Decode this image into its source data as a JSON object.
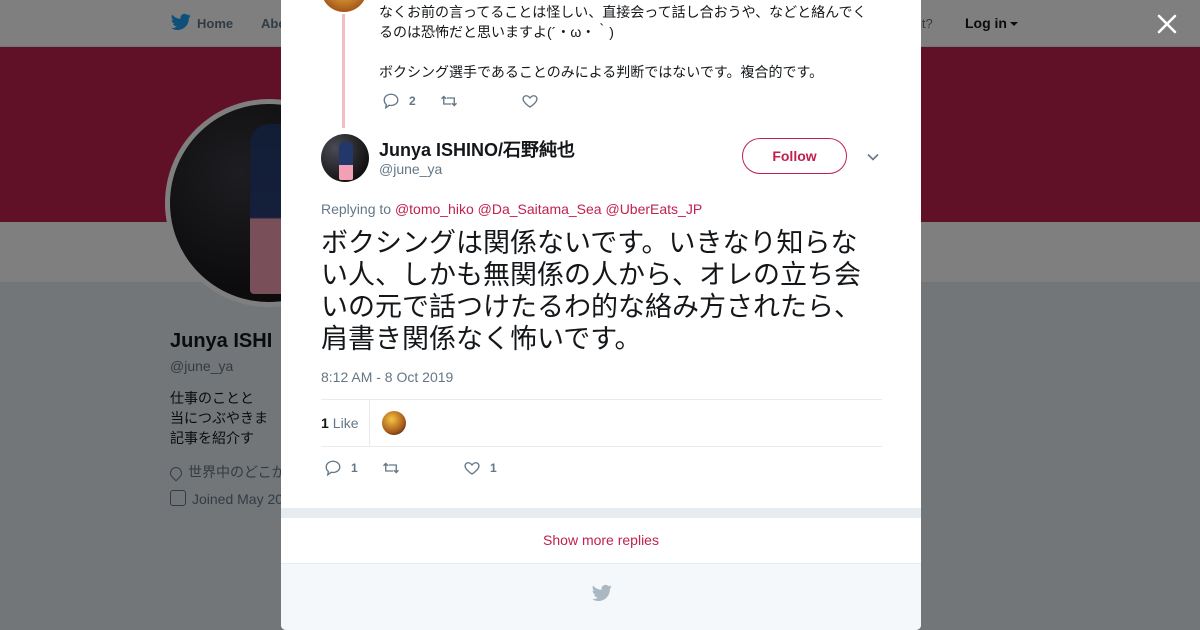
{
  "background": {
    "nav": {
      "home_label": "Home",
      "about_label": "Abo",
      "account_prompt": "account?",
      "login_label": "Log in"
    },
    "profile": {
      "name": "Junya ISHI",
      "handle": "@june_ya",
      "bio": "仕事のことと\n当につぶやきま\n記事を紹介す",
      "location": "世界中のどこか",
      "joined": "Joined May 20"
    }
  },
  "colors": {
    "accent": "#c0214f",
    "thread_line": "#f3bcc9",
    "muted": "#657786"
  },
  "modal": {
    "previous_tweet": {
      "text": "なくお前の言ってることは怪しい、直接会って話し合おうや、などと絡んでく\nるのは恐怖だと思いますよ(´・ω・｀)\n\nボクシング選手であることのみによる判断ではないです。複合的です。",
      "replies": "2",
      "retweets": "",
      "likes": ""
    },
    "tweet": {
      "author_name": "Junya ISHINO/石野純也",
      "author_handle": "@june_ya",
      "follow_label": "Follow",
      "replying_prefix": "Replying to",
      "replying_to": [
        "@tomo_hiko",
        "@Da_Saitama_Sea",
        "@UberEats_JP"
      ],
      "text": "ボクシングは関係ないです。いきなり知らない人、しかも無関係の人から、オレの立ち会いの元で話つけたるわ的な絡み方されたら、肩書き関係なく怖いです。",
      "timestamp": "8:12 AM - 8 Oct 2019",
      "like_count": "1",
      "like_label": "Like",
      "reply_count": "1",
      "retweet_count": "",
      "favorite_count": "1"
    },
    "show_more_replies": "Show more replies"
  },
  "icons": [
    "twitter-bird-icon",
    "close-icon",
    "reply-icon",
    "retweet-icon",
    "heart-icon",
    "chevron-down-icon",
    "location-pin-icon",
    "calendar-icon"
  ]
}
